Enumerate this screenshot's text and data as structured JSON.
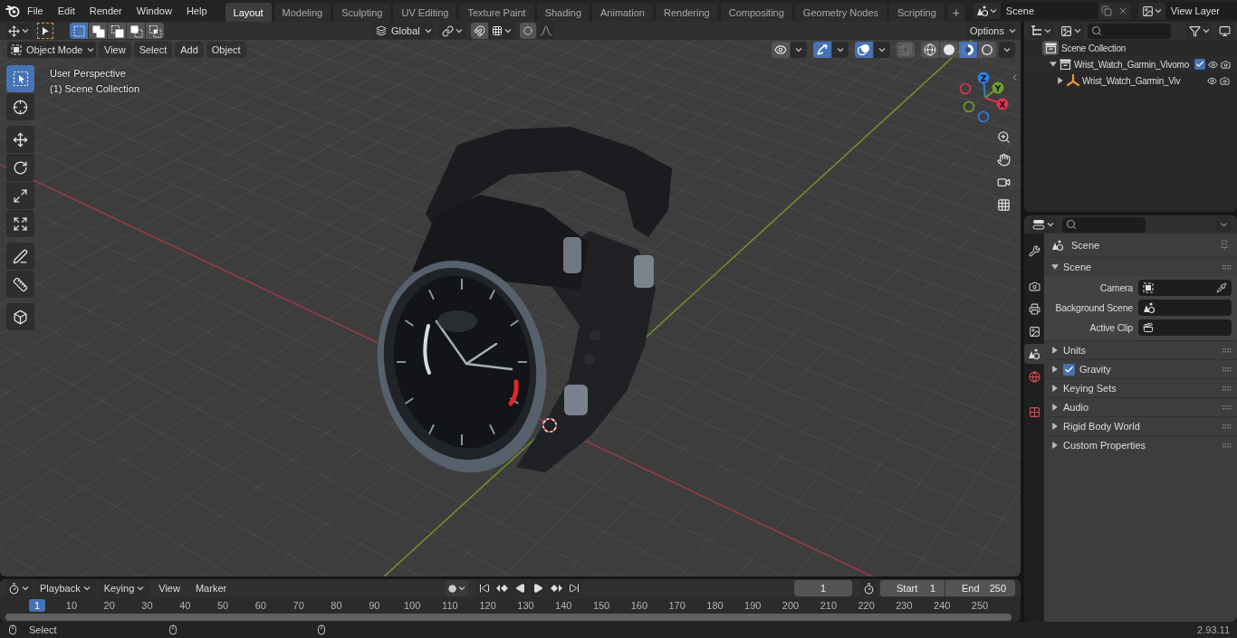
{
  "menu_bar": {
    "menus": [
      "File",
      "Edit",
      "Render",
      "Window",
      "Help"
    ]
  },
  "workspaces": [
    {
      "label": "Layout",
      "selected": true
    },
    {
      "label": "Modeling",
      "selected": false
    },
    {
      "label": "Sculpting",
      "selected": false
    },
    {
      "label": "UV Editing",
      "selected": false
    },
    {
      "label": "Texture Paint",
      "selected": false
    },
    {
      "label": "Shading",
      "selected": false
    },
    {
      "label": "Animation",
      "selected": false
    },
    {
      "label": "Rendering",
      "selected": false
    },
    {
      "label": "Compositing",
      "selected": false
    },
    {
      "label": "Geometry Nodes",
      "selected": false
    },
    {
      "label": "Scripting",
      "selected": false
    }
  ],
  "add_workspace": "+",
  "scene": {
    "value": "Scene"
  },
  "view_layer": {
    "value": "View Layer"
  },
  "viewport": {
    "select_modes": [
      {
        "kind": "set",
        "selected": true
      },
      {
        "kind": "extend",
        "selected": false
      },
      {
        "kind": "subtract",
        "selected": false
      },
      {
        "kind": "difference",
        "selected": false
      },
      {
        "kind": "intersect",
        "selected": false
      }
    ],
    "orientation": "Global",
    "options": "Options",
    "mode": "Object Mode",
    "menus": [
      "View",
      "Select",
      "Add",
      "Object"
    ],
    "toggles": [
      {
        "kind": "visibility",
        "on": false
      },
      {
        "kind": "gizmos",
        "on": true
      },
      {
        "kind": "overlays",
        "on": true
      },
      {
        "kind": "xray",
        "on": false
      }
    ],
    "shading": [
      {
        "kind": "wireframe",
        "selected": false
      },
      {
        "kind": "solid",
        "selected": false
      },
      {
        "kind": "material",
        "selected": true
      },
      {
        "kind": "rendered",
        "selected": false
      }
    ],
    "info": [
      "User Perspective",
      "(1) Scene Collection"
    ],
    "tools": [
      {
        "kind": "select",
        "selected": true
      },
      {
        "kind": "cursor",
        "selected": false
      },
      {
        "kind": "move",
        "selected": false
      },
      {
        "kind": "rotate",
        "selected": false
      },
      {
        "kind": "scale",
        "selected": false
      },
      {
        "kind": "transform",
        "selected": false
      },
      {
        "kind": "annotate",
        "selected": false
      },
      {
        "kind": "measure",
        "selected": false
      },
      {
        "kind": "add_cube",
        "selected": false
      }
    ],
    "axes": [
      {
        "label": "Z",
        "color": "#2e7fe0"
      },
      {
        "label": "Y",
        "color": "#6ea02a"
      },
      {
        "label": "X",
        "color": "#e0334f"
      }
    ]
  },
  "outliner": {
    "items": [
      {
        "label": "Scene Collection",
        "kind": "scene",
        "children": [
          {
            "label": "Wrist_Watch_Garmin_Vivomo",
            "kind": "collection",
            "expanded": true,
            "checked": true,
            "children": [
              {
                "label": "Wrist_Watch_Garmin_Viv",
                "kind": "object",
                "expanded": false
              }
            ]
          }
        ]
      }
    ]
  },
  "properties": {
    "tabs": [
      {
        "kind": "tool",
        "selected": false
      },
      {
        "kind": "render",
        "selected": false
      },
      {
        "kind": "output",
        "selected": false
      },
      {
        "kind": "view_layer",
        "selected": false
      },
      {
        "kind": "scene",
        "selected": true
      },
      {
        "kind": "world",
        "selected": false
      },
      {
        "kind": "texture",
        "selected": false
      }
    ],
    "context": "Scene",
    "panels": [
      {
        "title": "Scene",
        "expanded": true,
        "fields": [
          {
            "label": "Camera",
            "kind": "object"
          },
          {
            "label": "Background Scene",
            "kind": "scene"
          },
          {
            "label": "Active Clip",
            "kind": "clip"
          }
        ]
      },
      {
        "title": "Units",
        "expanded": false
      },
      {
        "title": "Gravity",
        "expanded": false,
        "checked": true
      },
      {
        "title": "Keying Sets",
        "expanded": false
      },
      {
        "title": "Audio",
        "expanded": false
      },
      {
        "title": "Rigid Body World",
        "expanded": false
      },
      {
        "title": "Custom Properties",
        "expanded": false
      }
    ]
  },
  "timeline": {
    "menus": [
      {
        "label": "Playback",
        "dropdown": true
      },
      {
        "label": "Keying",
        "dropdown": true
      },
      {
        "label": "View",
        "dropdown": false
      },
      {
        "label": "Marker",
        "dropdown": false
      }
    ],
    "current_frame": "1",
    "start": {
      "label": "Start",
      "value": "1"
    },
    "end": {
      "label": "End",
      "value": "250"
    },
    "ruler": [
      {
        "label": "1",
        "selected": true
      },
      {
        "label": "10",
        "selected": false
      },
      {
        "label": "20",
        "selected": false
      },
      {
        "label": "30",
        "selected": false
      },
      {
        "label": "40",
        "selected": false
      },
      {
        "label": "50",
        "selected": false
      },
      {
        "label": "60",
        "selected": false
      },
      {
        "label": "70",
        "selected": false
      },
      {
        "label": "80",
        "selected": false
      },
      {
        "label": "90",
        "selected": false
      },
      {
        "label": "100",
        "selected": false
      },
      {
        "label": "110",
        "selected": false
      },
      {
        "label": "120",
        "selected": false
      },
      {
        "label": "130",
        "selected": false
      },
      {
        "label": "140",
        "selected": false
      },
      {
        "label": "150",
        "selected": false
      },
      {
        "label": "160",
        "selected": false
      },
      {
        "label": "170",
        "selected": false
      },
      {
        "label": "180",
        "selected": false
      },
      {
        "label": "190",
        "selected": false
      },
      {
        "label": "200",
        "selected": false
      },
      {
        "label": "210",
        "selected": false
      },
      {
        "label": "220",
        "selected": false
      },
      {
        "label": "230",
        "selected": false
      },
      {
        "label": "240",
        "selected": false
      },
      {
        "label": "250",
        "selected": false
      }
    ]
  },
  "status_bar": {
    "hint": "Select",
    "version": "2.93.11"
  }
}
